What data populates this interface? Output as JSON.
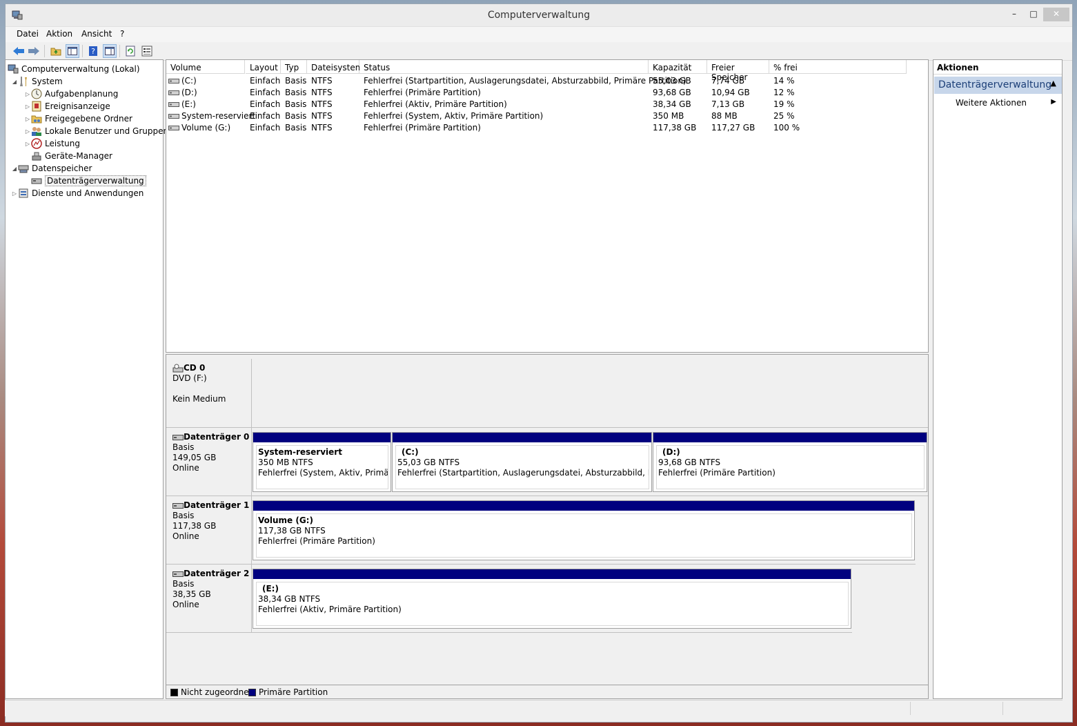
{
  "window": {
    "title": "Computerverwaltung",
    "minimize": "–",
    "maximize": "□",
    "close": "✕"
  },
  "menu": [
    "Datei",
    "Aktion",
    "Ansicht",
    "?"
  ],
  "tree": {
    "root": "Computerverwaltung (Lokal)",
    "system": "System",
    "system_children": [
      "Aufgabenplanung",
      "Ereignisanzeige",
      "Freigegebene Ordner",
      "Lokale Benutzer und Gruppen",
      "Leistung",
      "Geräte-Manager"
    ],
    "storage": "Datenspeicher",
    "storage_children": [
      "Datenträgerverwaltung"
    ],
    "services": "Dienste und Anwendungen"
  },
  "volume_list": {
    "columns": [
      "Volume",
      "Layout",
      "Typ",
      "Dateisystem",
      "Status",
      "Kapazität",
      "Freier Speicher",
      "% frei"
    ],
    "rows": [
      [
        "(C:)",
        "Einfach",
        "Basis",
        "NTFS",
        "Fehlerfrei (Startpartition, Auslagerungsdatei, Absturzabbild, Primäre Partition)",
        "55,03 GB",
        "7,74 GB",
        "14 %"
      ],
      [
        "(D:)",
        "Einfach",
        "Basis",
        "NTFS",
        "Fehlerfrei (Primäre Partition)",
        "93,68 GB",
        "10,94 GB",
        "12 %"
      ],
      [
        "(E:)",
        "Einfach",
        "Basis",
        "NTFS",
        "Fehlerfrei (Aktiv, Primäre Partition)",
        "38,34 GB",
        "7,13 GB",
        "19 %"
      ],
      [
        "System-reserviert",
        "Einfach",
        "Basis",
        "NTFS",
        "Fehlerfrei (System, Aktiv, Primäre Partition)",
        "350 MB",
        "88 MB",
        "25 %"
      ],
      [
        "Volume (G:)",
        "Einfach",
        "Basis",
        "NTFS",
        "Fehlerfrei (Primäre Partition)",
        "117,38 GB",
        "117,27 GB",
        "100 %"
      ]
    ]
  },
  "disks": {
    "cd0": {
      "name": "CD 0",
      "line1": "DVD (F:)",
      "line2": "Kein Medium"
    },
    "disk0": {
      "name": "Datenträger 0",
      "type": "Basis",
      "size": "149,05 GB",
      "state": "Online",
      "partitions": [
        {
          "name": "System-reserviert",
          "size": "350 MB NTFS",
          "status": "Fehlerfrei (System, Aktiv, Primäre Partition)"
        },
        {
          "name": "(C:)",
          "size": "55,03 GB NTFS",
          "status": "Fehlerfrei (Startpartition, Auslagerungsdatei, Absturzabbild, Primäre Partition)"
        },
        {
          "name": "(D:)",
          "size": "93,68 GB NTFS",
          "status": "Fehlerfrei (Primäre Partition)"
        }
      ]
    },
    "disk1": {
      "name": "Datenträger 1",
      "type": "Basis",
      "size": "117,38 GB",
      "state": "Online",
      "partitions": [
        {
          "name": "Volume  (G:)",
          "size": "117,38 GB NTFS",
          "status": "Fehlerfrei (Primäre Partition)"
        }
      ]
    },
    "disk2": {
      "name": "Datenträger 2",
      "type": "Basis",
      "size": "38,35 GB",
      "state": "Online",
      "partitions": [
        {
          "name": "(E:)",
          "size": "38,34 GB NTFS",
          "status": "Fehlerfrei (Aktiv, Primäre Partition)"
        }
      ]
    }
  },
  "legend": [
    {
      "label": "Nicht zugeordnet",
      "color": "#000000"
    },
    {
      "label": "Primäre Partition",
      "color": "#01017f"
    }
  ],
  "actions": {
    "header": "Aktionen",
    "section": "Datenträgerverwaltung",
    "item": "Weitere Aktionen"
  },
  "colors": {
    "partition_bar": "#01017f",
    "actions_section_bg": "#c7d6ea"
  }
}
